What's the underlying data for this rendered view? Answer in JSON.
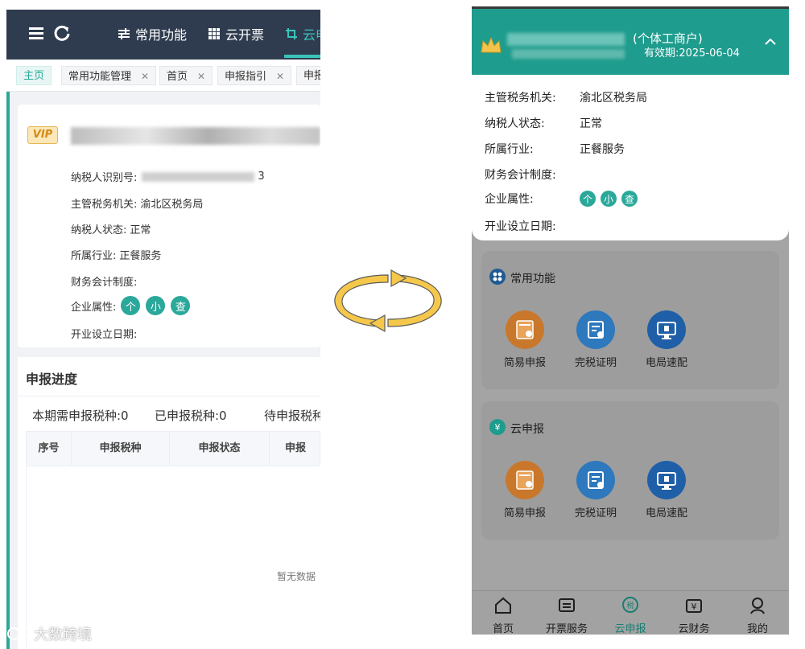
{
  "desktop": {
    "topbar": {
      "nav": [
        {
          "label": "常用功能",
          "icon": "sliders-icon"
        },
        {
          "label": "云开票",
          "icon": "grid-icon"
        },
        {
          "label": "云申",
          "icon": "crop-icon"
        }
      ]
    },
    "tabs": [
      {
        "label": "主页",
        "closable": false
      },
      {
        "label": "常用功能管理",
        "closable": true
      },
      {
        "label": "首页",
        "closable": true
      },
      {
        "label": "申报指引",
        "closable": true
      },
      {
        "label": "申报",
        "closable": false
      }
    ],
    "info": {
      "vip": "VIP",
      "tax_id_label": "纳税人识别号:",
      "tax_id_value": "3",
      "authority_label": "主管税务机关:",
      "authority_value": "渝北区税务局",
      "status_label": "纳税人状态:",
      "status_value": "正常",
      "industry_label": "所属行业:",
      "industry_value": "正餐服务",
      "accounting_label": "财务会计制度:",
      "attr_label": "企业属性:",
      "attrs": [
        "个",
        "小",
        "查"
      ],
      "founding_label": "开业设立日期:"
    },
    "progress": {
      "title": "申报进度",
      "stats": [
        "本期需申报税种:0",
        "已申报税种:0",
        "待申报税种"
      ],
      "columns": [
        "序号",
        "申报税种",
        "申报状态",
        "申报"
      ],
      "empty": "暂无数据"
    }
  },
  "mobile": {
    "header": {
      "type": "(个体工商户)",
      "expiry": "有效期:2025-06-04"
    },
    "info": {
      "rows": [
        {
          "label": "主管税务机关:",
          "value": "渝北区税务局"
        },
        {
          "label": "纳税人状态:",
          "value": "正常"
        },
        {
          "label": "所属行业:",
          "value": "正餐服务"
        },
        {
          "label": "财务会计制度:",
          "value": ""
        }
      ],
      "attr_label": "企业属性:",
      "attrs": [
        "个",
        "小",
        "查"
      ],
      "founding_label": "开业设立日期:"
    },
    "sections": [
      {
        "title": "常用功能",
        "items": [
          "简易申报",
          "完税证明",
          "电局速配"
        ]
      },
      {
        "title": "云申报",
        "items": [
          "简易申报",
          "完税证明",
          "电局速配"
        ]
      }
    ],
    "nav": [
      {
        "label": "首页",
        "icon": "home-icon"
      },
      {
        "label": "开票服务",
        "icon": "invoice-icon"
      },
      {
        "label": "云申报",
        "icon": "tax-icon"
      },
      {
        "label": "云财务",
        "icon": "finance-icon"
      },
      {
        "label": "我的",
        "icon": "user-icon"
      }
    ],
    "active_nav": 2
  },
  "watermark": "大数跨境",
  "colors": {
    "teal": "#2aa89a",
    "dark_topbar": "#2f3c4f",
    "orange": "#e8902f",
    "blue": "#2f86d6",
    "arrow_yellow": "#f5c84b"
  }
}
